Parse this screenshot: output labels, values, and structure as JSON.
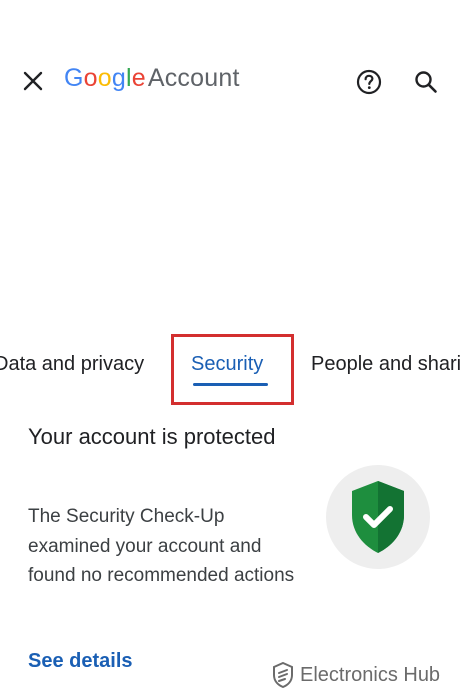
{
  "header": {
    "logo_letters": [
      {
        "ch": "G",
        "color": "#4285F4"
      },
      {
        "ch": "o",
        "color": "#EA4335"
      },
      {
        "ch": "o",
        "color": "#FBBC05"
      },
      {
        "ch": "g",
        "color": "#4285F4"
      },
      {
        "ch": "l",
        "color": "#34A853"
      },
      {
        "ch": "e",
        "color": "#EA4335"
      }
    ],
    "logo_word": "Account",
    "icons": [
      "close-icon",
      "help-icon",
      "search-icon"
    ]
  },
  "tabs": [
    {
      "label": "Data and privacy",
      "active": false
    },
    {
      "label": "Security",
      "active": true
    },
    {
      "label": "People and sharing",
      "active": false
    }
  ],
  "card": {
    "title": "Your account is protected",
    "description": "The Security Check-Up examined your account and found no recommended actions",
    "link": "See details",
    "shield_color": "#1e8e3e"
  },
  "watermark": {
    "brand": "Electronics Hub"
  },
  "colors": {
    "accent": "#1a5fb4",
    "highlight": "#d32f2f"
  }
}
